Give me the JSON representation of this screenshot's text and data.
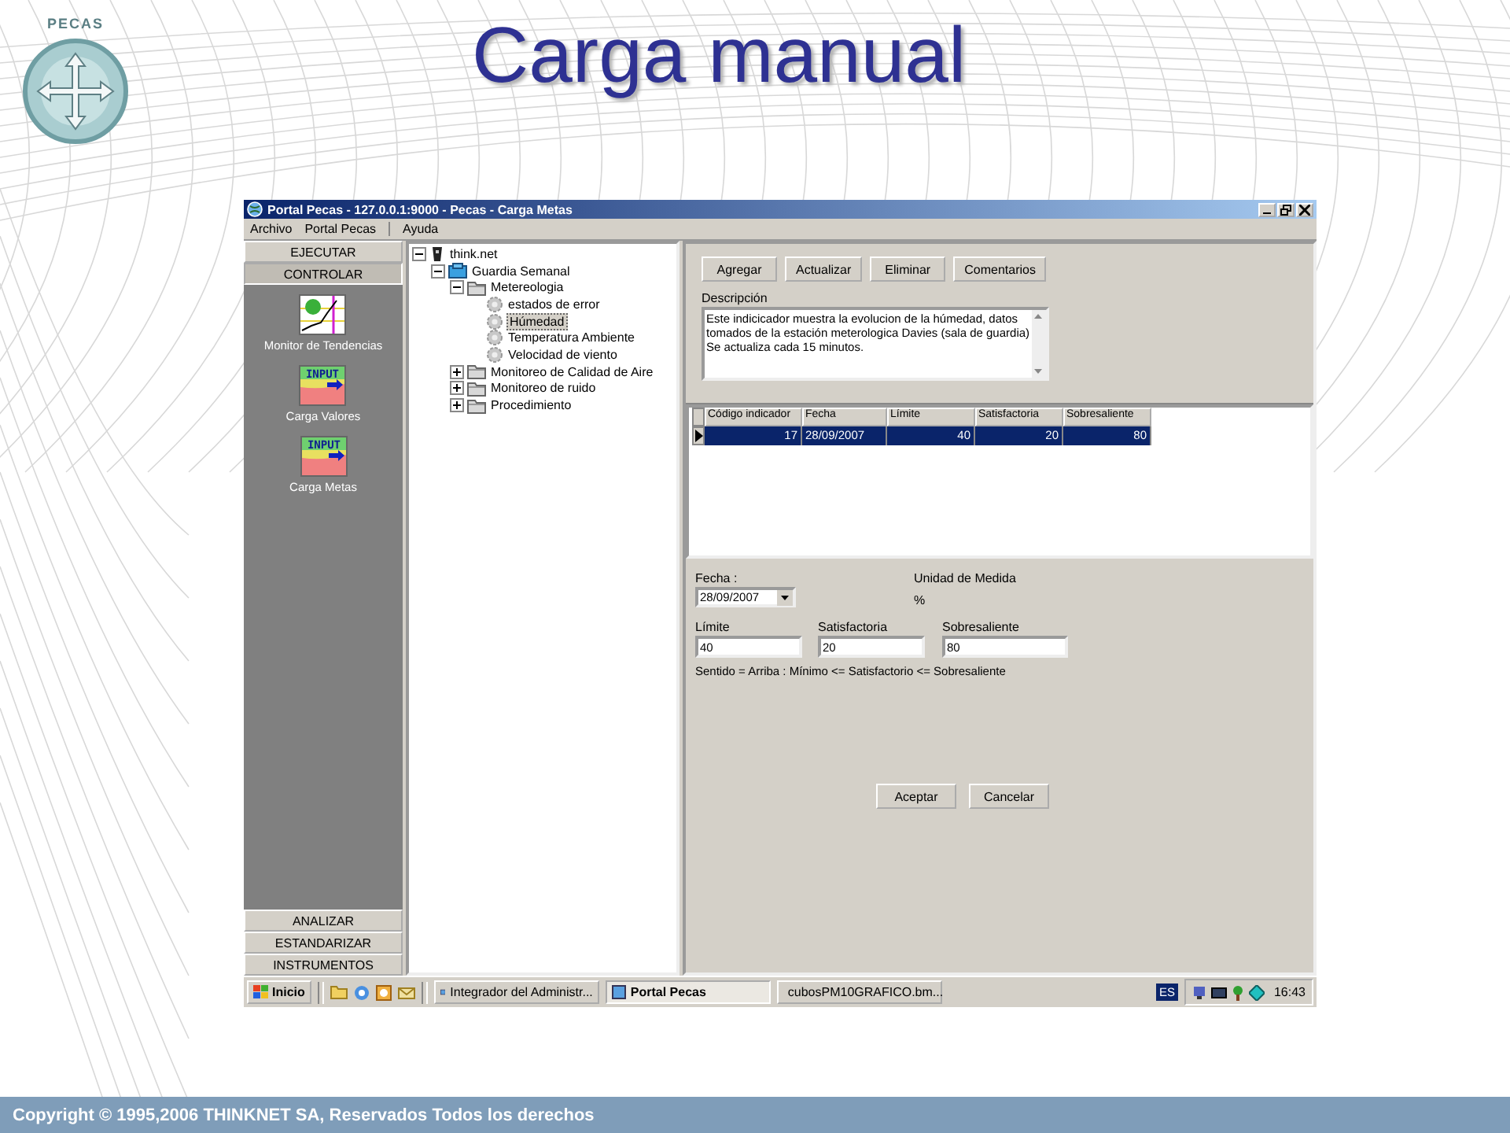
{
  "slide": {
    "title": "Carga manual",
    "logo_text": "PECAS",
    "footer": "Copyright © 1995,2006 THINKNET SA, Reservados Todos los derechos"
  },
  "window": {
    "title": "Portal Pecas - 127.0.0.1:9000 - Pecas - Carga Metas"
  },
  "menu": [
    "Archivo",
    "Portal Pecas",
    "Ayuda"
  ],
  "nav": {
    "top": [
      {
        "label": "EJECUTAR",
        "selected": false
      },
      {
        "label": "CONTROLAR",
        "selected": true
      }
    ],
    "tools": [
      {
        "label": "Monitor de Tendencias",
        "kind": "chart"
      },
      {
        "label": "Carga Valores",
        "kind": "input",
        "icon_text": "INPUT"
      },
      {
        "label": "Carga Metas",
        "kind": "input",
        "icon_text": "INPUT"
      }
    ],
    "bottom": [
      {
        "label": "ANALIZAR",
        "selected": false
      },
      {
        "label": "ESTANDARIZAR",
        "selected": false
      },
      {
        "label": "INSTRUMENTOS",
        "selected": false
      }
    ]
  },
  "tree": [
    {
      "label": "think.net",
      "kind": "root",
      "expanded": true,
      "selected": false,
      "children": [
        {
          "label": "Guardia Semanal",
          "kind": "group",
          "expanded": true,
          "selected": false,
          "children": [
            {
              "label": "Metereologia",
              "kind": "folder",
              "expanded": true,
              "selected": false,
              "children": [
                {
                  "label": "estados de error",
                  "kind": "leaf",
                  "selected": false
                },
                {
                  "label": "Húmedad",
                  "kind": "leaf",
                  "selected": true
                },
                {
                  "label": "Temperatura Ambiente",
                  "kind": "leaf",
                  "selected": false
                },
                {
                  "label": "Velocidad de viento",
                  "kind": "leaf",
                  "selected": false
                }
              ]
            },
            {
              "label": "Monitoreo de Calidad de Aire",
              "kind": "folder",
              "expanded": false,
              "selected": false
            },
            {
              "label": "Monitoreo de ruido",
              "kind": "folder",
              "expanded": false,
              "selected": false
            },
            {
              "label": "Procedimiento",
              "kind": "folder",
              "expanded": false,
              "selected": false
            }
          ]
        }
      ]
    }
  ],
  "toolbar": [
    "Agregar",
    "Actualizar",
    "Eliminar",
    "Comentarios"
  ],
  "description": {
    "label": "Descripción",
    "value": "Este indicicador muestra la evolucion de la húmedad, datos\ntomados de la estación meterologica Davies (sala de guardia)\nSe actualiza cada 15 minutos."
  },
  "table": {
    "columns": [
      "Código indicador",
      "Fecha",
      "Límite",
      "Satisfactoria",
      "Sobresaliente"
    ],
    "rows": [
      {
        "cells": [
          "17",
          "28/09/2007",
          "40",
          "20",
          "80"
        ],
        "selected": true
      }
    ]
  },
  "form": {
    "fecha_label": "Fecha :",
    "fecha": "28/09/2007",
    "unidad_label": "Unidad de Medida",
    "unidad": "%",
    "fields": [
      {
        "label": "Límite",
        "value": "40"
      },
      {
        "label": "Satisfactoria",
        "value": "20"
      },
      {
        "label": "Sobresaliente",
        "value": "80"
      }
    ],
    "note": "Sentido = Arriba  :  Mínimo <= Satisfactorio <= Sobresaliente",
    "buttons": [
      "Aceptar",
      "Cancelar"
    ]
  },
  "taskbar": {
    "start": "Inicio",
    "tasks": [
      {
        "label": "Integrador del Administr...",
        "selected": false
      },
      {
        "label": "Portal Pecas",
        "selected": true
      },
      {
        "label": "cubosPM10GRAFICO.bm...",
        "selected": false
      }
    ],
    "language": "ES",
    "time": "16:43"
  }
}
